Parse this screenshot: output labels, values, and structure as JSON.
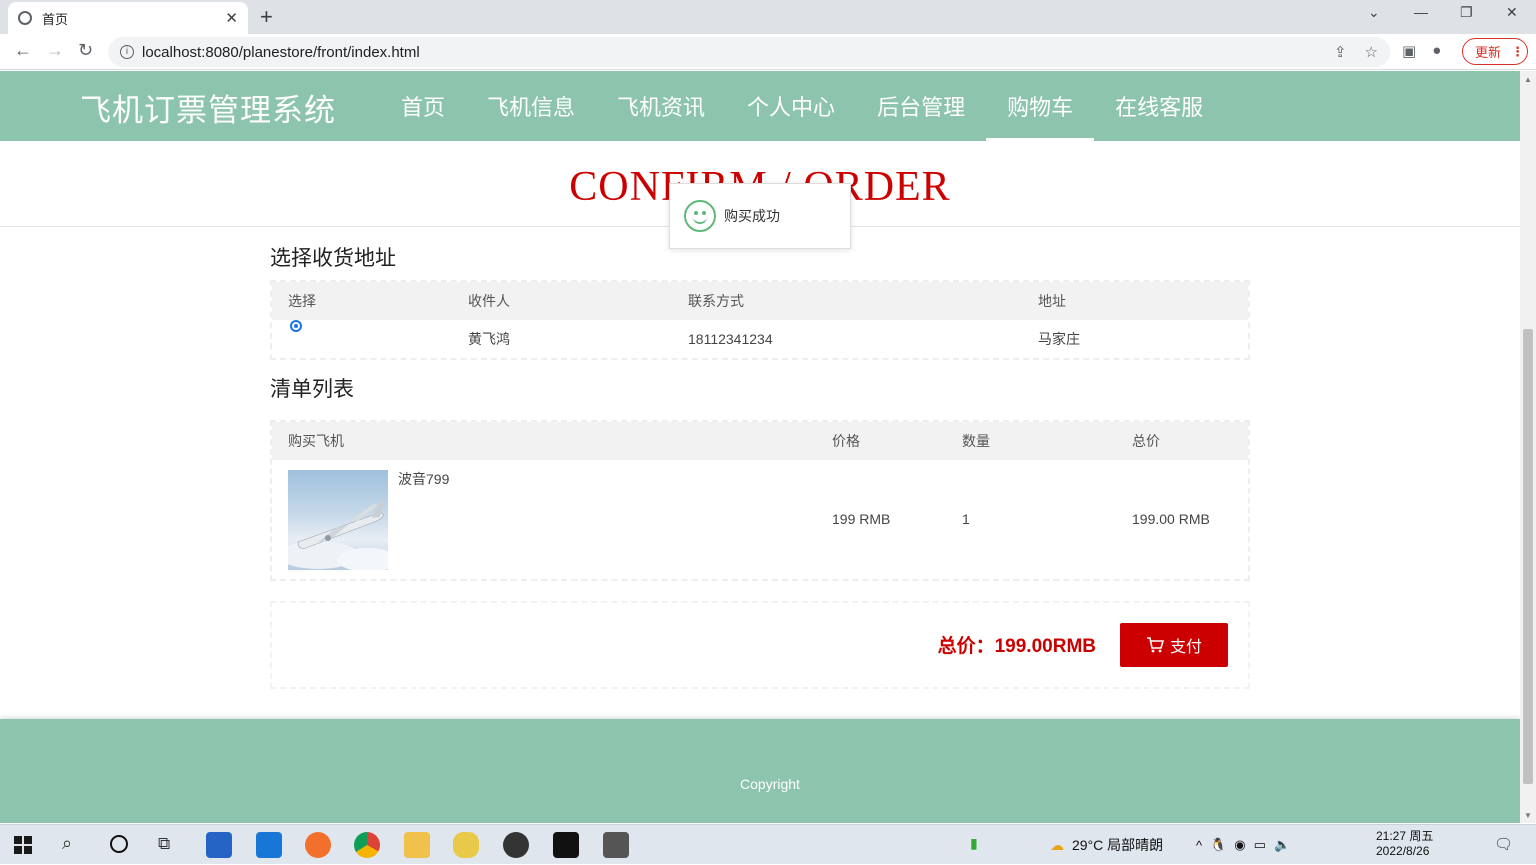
{
  "browser": {
    "tab_title": "首页",
    "url": "localhost:8080/planestore/front/index.html",
    "update_label": "更新"
  },
  "site": {
    "logo": "飞机订票管理系统",
    "nav": [
      {
        "label": "首页",
        "active": false
      },
      {
        "label": "飞机信息",
        "active": false
      },
      {
        "label": "飞机资讯",
        "active": false
      },
      {
        "label": "个人中心",
        "active": false
      },
      {
        "label": "后台管理",
        "active": false
      },
      {
        "label": "购物车",
        "active": true
      },
      {
        "label": "在线客服",
        "active": false
      }
    ],
    "banner_title": "CONFIRM / ORDER"
  },
  "toast": {
    "message": "购买成功",
    "icon": "smile-icon"
  },
  "address_section": {
    "title": "选择收货地址",
    "headers": [
      "选择",
      "收件人",
      "联系方式",
      "地址"
    ],
    "rows": [
      {
        "selected": true,
        "recipient": "黄飞鸿",
        "phone": "18112341234",
        "address": "马家庄"
      }
    ]
  },
  "list_section": {
    "title": "清单列表",
    "headers": [
      "购买飞机",
      "价格",
      "数量",
      "总价"
    ],
    "rows": [
      {
        "name": "波音799",
        "price": "199 RMB",
        "quantity": "1",
        "subtotal": "199.00 RMB"
      }
    ]
  },
  "summary": {
    "total": "总价：199.00RMB",
    "pay_label": "支付"
  },
  "footer": {
    "copyright": "Copyright"
  },
  "taskbar": {
    "weather": "29°C  局部晴朗",
    "time": "21:27 周五",
    "date": "2022/8/26"
  }
}
